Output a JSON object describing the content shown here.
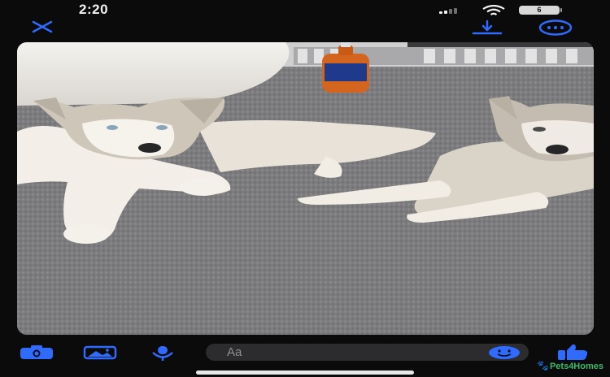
{
  "status_bar": {
    "time": "2:20",
    "battery_level": "6"
  },
  "top_bar": {
    "close_icon": "close-icon",
    "download_icon": "download-icon",
    "more_icon": "more-options-icon"
  },
  "composer": {
    "camera_icon": "camera-icon",
    "gallery_icon": "gallery-icon",
    "mic_icon": "microphone-icon",
    "placeholder": "Aa",
    "emoji_icon": "emoji-icon",
    "like_icon": "thumbs-up-icon"
  },
  "watermark": {
    "text": "Pets4Homes"
  },
  "colors": {
    "accent": "#2f6bff",
    "background": "#0b0b0c",
    "field": "#2c2c2e",
    "watermark": "#3fb86b"
  }
}
